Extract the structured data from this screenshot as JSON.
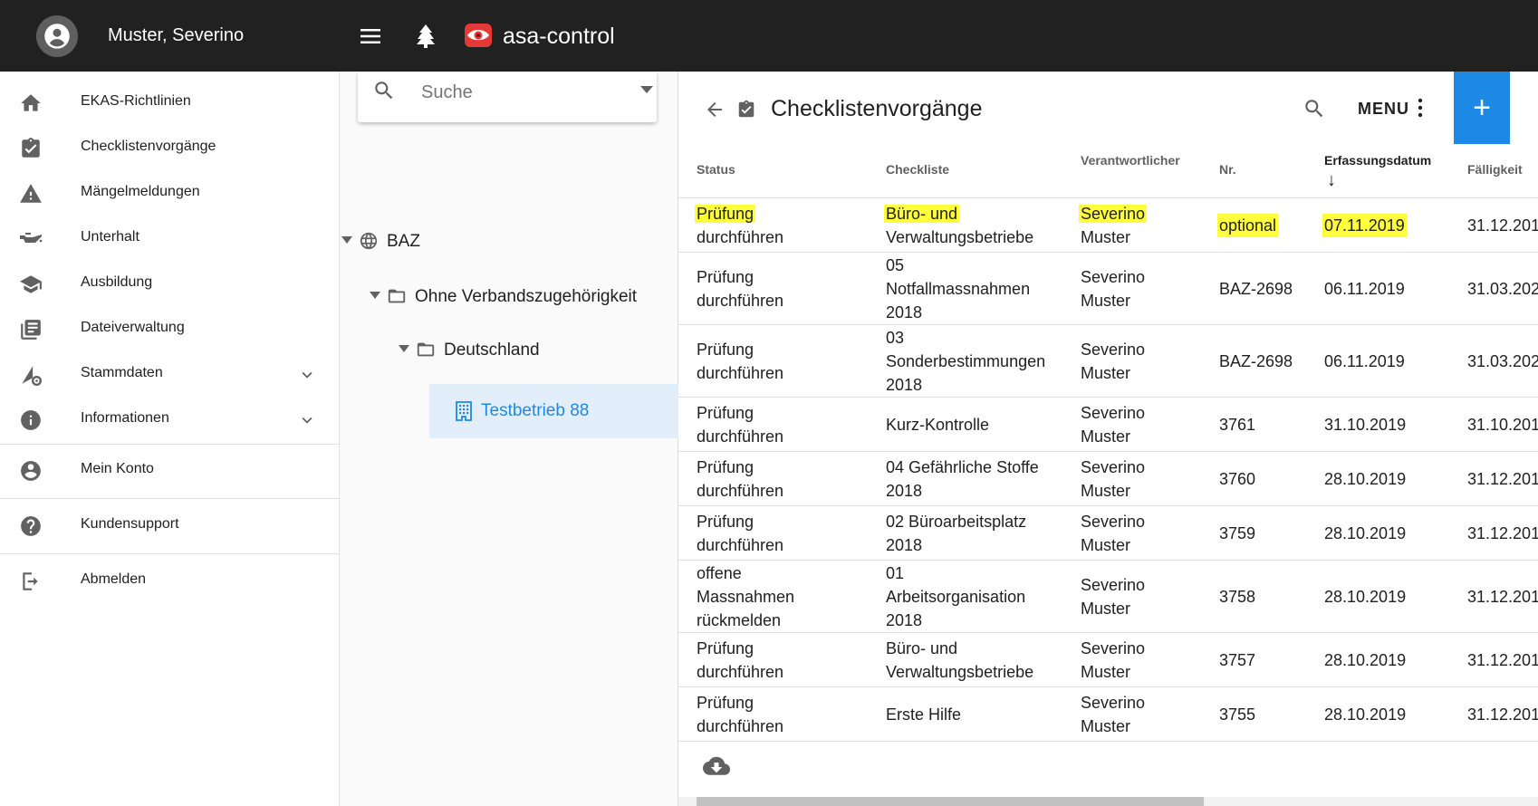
{
  "topbar": {
    "user_name": "Muster, Severino",
    "brand_name": "asa-control",
    "brand_color": "#e53935"
  },
  "sidebar": {
    "items": [
      {
        "label": "EKAS-Richtlinien",
        "icon": "home-icon"
      },
      {
        "label": "Checklistenvorgänge",
        "icon": "clipboard-check-icon"
      },
      {
        "label": "Mängelmeldungen",
        "icon": "warning-icon"
      },
      {
        "label": "Unterhalt",
        "icon": "oil-can-icon"
      },
      {
        "label": "Ausbildung",
        "icon": "graduation-cap-icon"
      },
      {
        "label": "Dateiverwaltung",
        "icon": "library-books-icon"
      },
      {
        "label": "Stammdaten",
        "icon": "settings-triangle-icon"
      },
      {
        "label": "Informationen",
        "icon": "info-icon"
      },
      {
        "label": "Mein Konto",
        "icon": "account-icon"
      },
      {
        "label": "Kundensupport",
        "icon": "help-icon"
      },
      {
        "label": "Abmelden",
        "icon": "logout-icon"
      }
    ]
  },
  "tree": {
    "search_placeholder": "Suche",
    "nodes": [
      {
        "label": "BAZ",
        "icon": "globe-icon"
      },
      {
        "label": "Ohne Verbandszugehörigkeit",
        "icon": "folder-icon"
      },
      {
        "label": "Deutschland",
        "icon": "folder-icon"
      },
      {
        "label": "Testbetrieb 88",
        "icon": "building-icon"
      }
    ]
  },
  "main": {
    "title": "Checklistenvorgänge",
    "menu_label": "MENU",
    "add_label": "+",
    "accent_color": "#1e88e5",
    "highlight_color": "#ffff3b",
    "columns": {
      "status": "Status",
      "checkliste": "Checkliste",
      "verantwortlicher": "Verantwortlicher",
      "nr": "Nr.",
      "erfassungsdatum": "Erfassungsdatum",
      "sort_arrow": "↓",
      "faelligkeit": "Fälligkeit"
    },
    "rows": [
      {
        "status": [
          "Prüfung",
          "durchführen"
        ],
        "checkliste": [
          "Büro- und",
          "Verwaltungsbetriebe"
        ],
        "verantwortlicher": [
          "Severino",
          "Muster"
        ],
        "nr": "optional",
        "erfassung": "07.11.2019",
        "faellig": "31.12.201"
      },
      {
        "status": [
          "Prüfung",
          "durchführen"
        ],
        "checkliste": [
          "05",
          "Notfallmassnahmen",
          "2018"
        ],
        "verantwortlicher": [
          "Severino",
          "Muster"
        ],
        "nr": "BAZ-2698",
        "erfassung": "06.11.2019",
        "faellig": "31.03.202"
      },
      {
        "status": [
          "Prüfung",
          "durchführen"
        ],
        "checkliste": [
          "03",
          "Sonderbestimmungen",
          "2018"
        ],
        "verantwortlicher": [
          "Severino",
          "Muster"
        ],
        "nr": "BAZ-2698",
        "erfassung": "06.11.2019",
        "faellig": "31.03.202"
      },
      {
        "status": [
          "Prüfung",
          "durchführen"
        ],
        "checkliste": [
          "Kurz-Kontrolle"
        ],
        "verantwortlicher": [
          "Severino",
          "Muster"
        ],
        "nr": "3761",
        "erfassung": "31.10.2019",
        "faellig": "31.10.201"
      },
      {
        "status": [
          "Prüfung",
          "durchführen"
        ],
        "checkliste": [
          "04 Gefährliche Stoffe",
          "2018"
        ],
        "verantwortlicher": [
          "Severino",
          "Muster"
        ],
        "nr": "3760",
        "erfassung": "28.10.2019",
        "faellig": "31.12.201"
      },
      {
        "status": [
          "Prüfung",
          "durchführen"
        ],
        "checkliste": [
          "02 Büroarbeitsplatz",
          "2018"
        ],
        "verantwortlicher": [
          "Severino",
          "Muster"
        ],
        "nr": "3759",
        "erfassung": "28.10.2019",
        "faellig": "31.12.201"
      },
      {
        "status": [
          "offene",
          "Massnahmen",
          "rückmelden"
        ],
        "checkliste": [
          "01",
          "Arbeitsorganisation",
          "2018"
        ],
        "verantwortlicher": [
          "Severino",
          "Muster"
        ],
        "nr": "3758",
        "erfassung": "28.10.2019",
        "faellig": "31.12.201"
      },
      {
        "status": [
          "Prüfung",
          "durchführen"
        ],
        "checkliste": [
          "Büro- und",
          "Verwaltungsbetriebe"
        ],
        "verantwortlicher": [
          "Severino",
          "Muster"
        ],
        "nr": "3757",
        "erfassung": "28.10.2019",
        "faellig": "31.12.201"
      },
      {
        "status": [
          "Prüfung",
          "durchführen"
        ],
        "checkliste": [
          "Erste Hilfe"
        ],
        "verantwortlicher": [
          "Severino",
          "Muster"
        ],
        "nr": "3755",
        "erfassung": "28.10.2019",
        "faellig": "31.12.201"
      }
    ]
  }
}
